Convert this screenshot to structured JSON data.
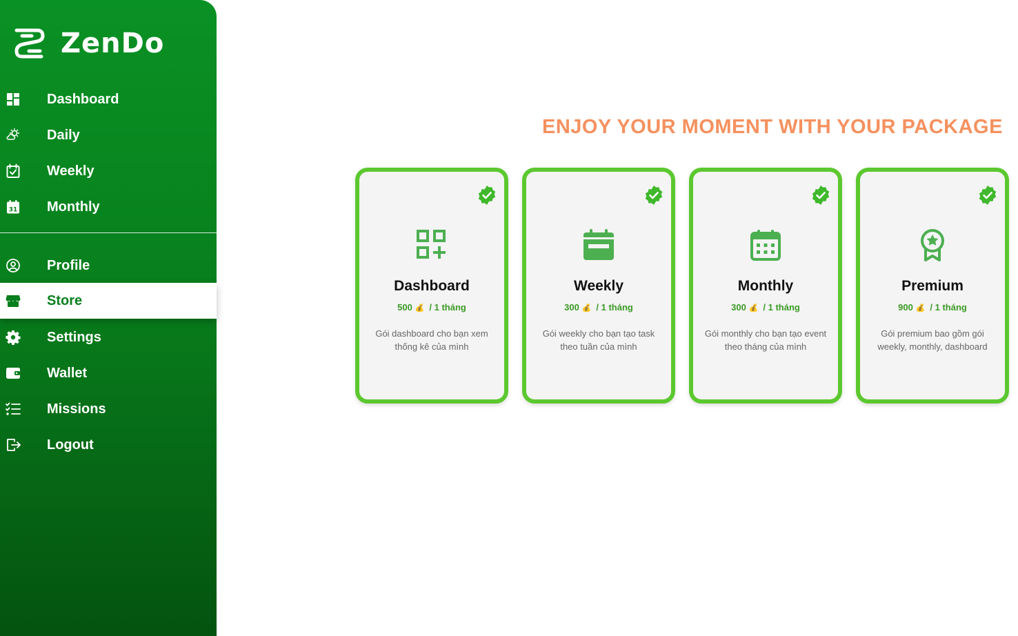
{
  "brand": {
    "name": "ZenDo"
  },
  "sidebar": {
    "items": [
      {
        "label": "Dashboard",
        "icon": "dashboard-icon"
      },
      {
        "label": "Daily",
        "icon": "weather-icon"
      },
      {
        "label": "Weekly",
        "icon": "calendar-check-icon"
      },
      {
        "label": "Monthly",
        "icon": "calendar-31-icon"
      },
      {
        "label": "Profile",
        "icon": "user-circle-icon"
      },
      {
        "label": "Store",
        "icon": "store-icon",
        "active": true
      },
      {
        "label": "Settings",
        "icon": "gear-icon"
      },
      {
        "label": "Wallet",
        "icon": "wallet-icon"
      },
      {
        "label": "Missions",
        "icon": "checklist-icon"
      },
      {
        "label": "Logout",
        "icon": "logout-icon"
      }
    ]
  },
  "main": {
    "headline": "ENJOY YOUR MOMENT WITH YOUR PACKAGE",
    "packages": [
      {
        "title": "Dashboard",
        "price": "500",
        "period": "/ 1 tháng",
        "description": "Gói dashboard cho bạn xem thống kê của mình",
        "icon": "apps-add-icon"
      },
      {
        "title": "Weekly",
        "price": "300",
        "period": "/ 1 tháng",
        "description": "Gói weekly cho bạn tạo task theo tuần của mình",
        "icon": "calendar-week-icon"
      },
      {
        "title": "Monthly",
        "price": "300",
        "period": "/ 1 tháng",
        "description": "Gói monthly cho bạn tạo event theo tháng của mình",
        "icon": "calendar-month-icon"
      },
      {
        "title": "Premium",
        "price": "900",
        "period": "/ 1 tháng",
        "description": "Gói premium bao gồm gói weekly, monthly, dashboard",
        "icon": "award-icon"
      }
    ]
  },
  "colors": {
    "sidebar_top": "#0a9124",
    "sidebar_bottom": "#04530f",
    "accent_green": "#5cc82f",
    "headline_orange": "#f5915f",
    "price_green": "#3a9a24"
  }
}
